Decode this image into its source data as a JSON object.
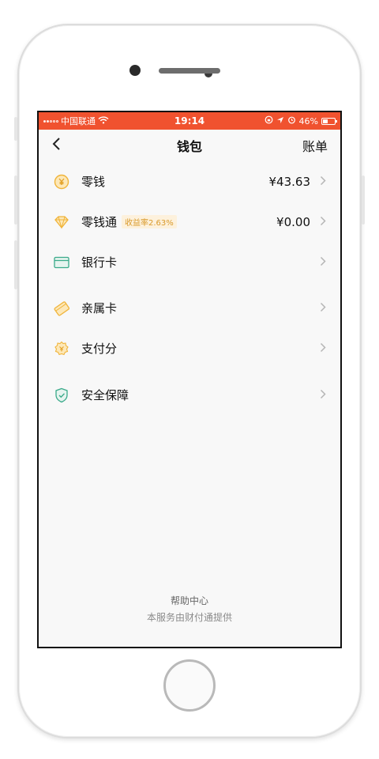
{
  "status_bar": {
    "carrier": "中国联通",
    "time": "19:14",
    "battery": "46%",
    "battery_level": 0.46,
    "accent": "#f0522f"
  },
  "nav": {
    "back_icon": "chevron-left-icon",
    "title": "钱包",
    "right": "账单"
  },
  "items": [
    {
      "label": "零钱",
      "value": "¥43.63",
      "icon": "yuan-coin-icon",
      "icon_color": "#f0b43a"
    },
    {
      "label": "零钱通",
      "badge": "收益率2.63%",
      "value": "¥0.00",
      "icon": "diamond-icon",
      "icon_color": "#f0b43a"
    },
    {
      "label": "银行卡",
      "icon": "bank-card-icon",
      "icon_color": "#3aaa8a"
    },
    {
      "label": "亲属卡",
      "icon": "family-card-icon",
      "icon_color": "#f0b43a"
    },
    {
      "label": "支付分",
      "icon": "pay-score-icon",
      "icon_color": "#f0b43a"
    },
    {
      "label": "安全保障",
      "icon": "shield-icon",
      "icon_color": "#3aaa8a"
    }
  ],
  "footer": {
    "help": "帮助中心",
    "provider": "本服务由财付通提供"
  }
}
